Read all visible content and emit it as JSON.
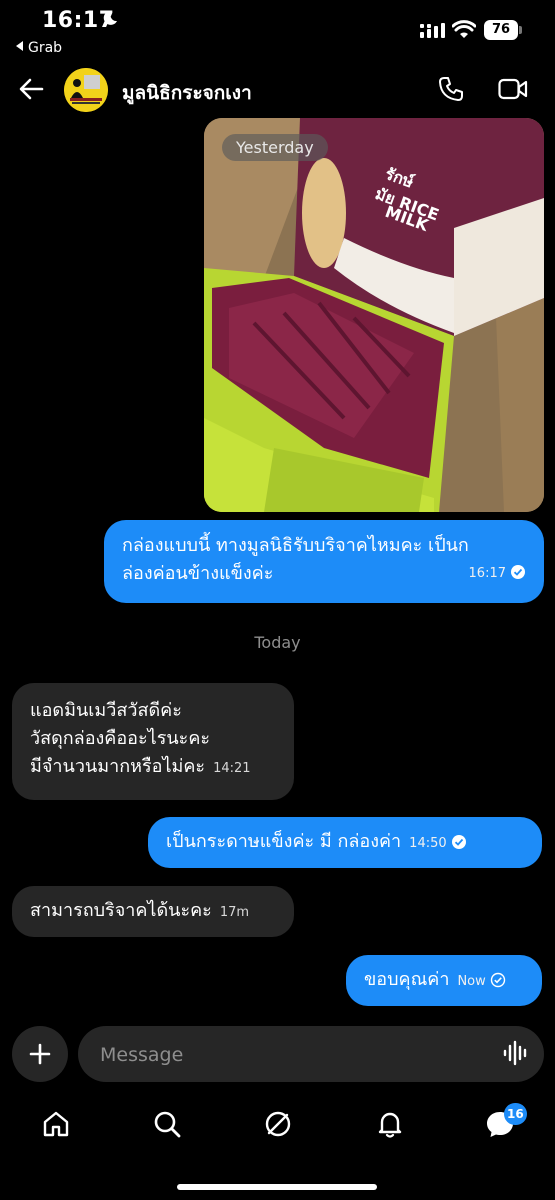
{
  "status_bar": {
    "time": "16:17",
    "back_app": "Grab",
    "battery": "76"
  },
  "header": {
    "contact_name": "มูลนิธิกระจกเงา"
  },
  "photo": {
    "day_label": "Yesterday",
    "box_text_line1": "รักษ์",
    "box_text_line2": "มัย RICE",
    "box_text_line3": "MILK"
  },
  "divider": {
    "today": "Today"
  },
  "messages": [
    {
      "side": "out",
      "line1": "กล่องแบบนี้ ทางมูลนิธิรับบริจาคไหมคะ เป็นก",
      "line2": "ล่องค่อนข้างแข็งค่ะ",
      "time": "16:17"
    },
    {
      "side": "in",
      "line1": "แอดมินเมวีสวัสดีค่ะ",
      "line2": "วัสดุกล่องคืออะไรนะคะ",
      "line3": "มีจำนวนมากหรือไม่คะ",
      "time": "14:21"
    },
    {
      "side": "out",
      "line1": "เป็นกระดาษแข็งค่ะ มี   กล่องค่า",
      "time": "14:50"
    },
    {
      "side": "in",
      "line1": "สามารถบริจาคได้นะคะ",
      "time": "17m"
    },
    {
      "side": "out",
      "line1": "ขอบคุณค่า",
      "time": "Now"
    }
  ],
  "composer": {
    "placeholder": "Message"
  },
  "tabbar": {
    "messages_badge": "16"
  },
  "colors": {
    "accent": "#1d8cf8",
    "incoming_bubble": "#262626",
    "background": "#000000"
  }
}
